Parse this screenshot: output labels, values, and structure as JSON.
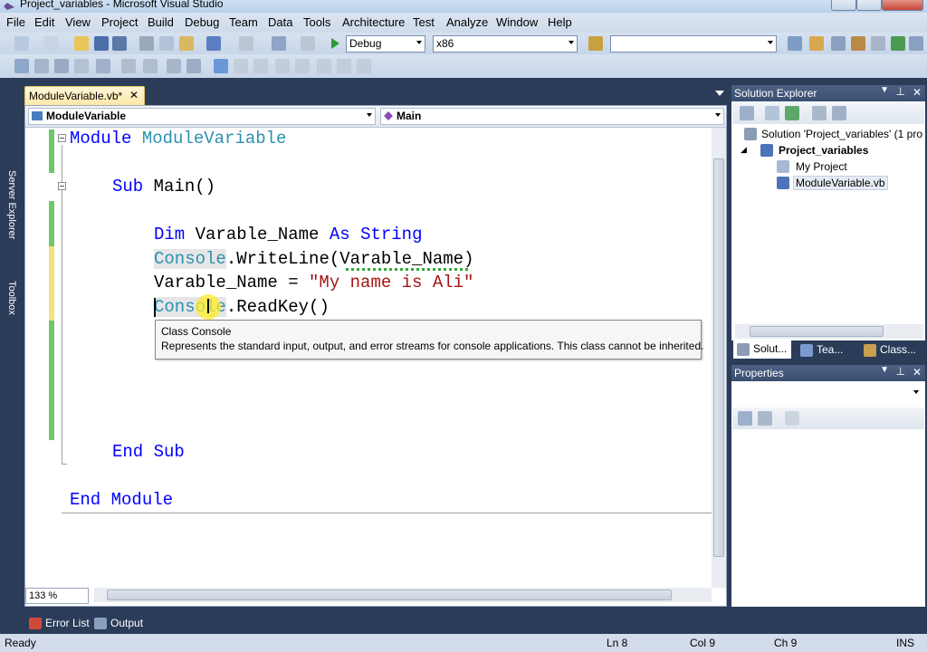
{
  "window": {
    "title": "Project_variables - Microsoft Visual Studio"
  },
  "menu": [
    "File",
    "Edit",
    "View",
    "Project",
    "Build",
    "Debug",
    "Team",
    "Data",
    "Tools",
    "Architecture",
    "Test",
    "Analyze",
    "Window",
    "Help"
  ],
  "toolbar": {
    "config": "Debug",
    "platform": "x86",
    "find": ""
  },
  "sidebar": {
    "server_explorer": "Server Explorer",
    "toolbox": "Toolbox"
  },
  "document": {
    "tab": "ModuleVariable.vb*",
    "type_combo": "ModuleVariable",
    "member_combo": "Main"
  },
  "code": {
    "l1_kw": "Module",
    "l1_name": "ModuleVariable",
    "l2_kw": "Sub",
    "l2_rest": "Main()",
    "l3_kw": "Dim",
    "l3_name": "Varable_Name",
    "l3_as": "As",
    "l3_type": "String",
    "l4_type": "Console",
    "l4_rest": ".WriteLine(Varable_Name)",
    "l5_name": "Varable_Name = ",
    "l5_str": "\"My name is Ali\"",
    "l6_type": "Console",
    "l6_rest": ".ReadKey()",
    "l7": "End Sub",
    "l8": "End Module"
  },
  "tooltip": {
    "title": "Class Console",
    "desc": "Represents the standard input, output, and error streams for console applications. This class cannot be inherited."
  },
  "editor": {
    "zoom": "133 %"
  },
  "solution_explorer": {
    "title": "Solution Explorer",
    "solution": "Solution 'Project_variables' (1 pro",
    "project": "Project_variables",
    "items": [
      "My Project",
      "ModuleVariable.vb"
    ],
    "tabs": [
      "Solut...",
      "Tea...",
      "Class..."
    ]
  },
  "properties": {
    "title": "Properties"
  },
  "bottom_tabs": [
    "Error List",
    "Output"
  ],
  "status": {
    "text": "Ready",
    "ln": "Ln 8",
    "col": "Col 9",
    "ch": "Ch 9",
    "mode": "INS"
  },
  "colors": {
    "chrome": "#2b3c59",
    "keyword": "#0000ff",
    "type": "#2b91af",
    "string": "#a31515"
  }
}
